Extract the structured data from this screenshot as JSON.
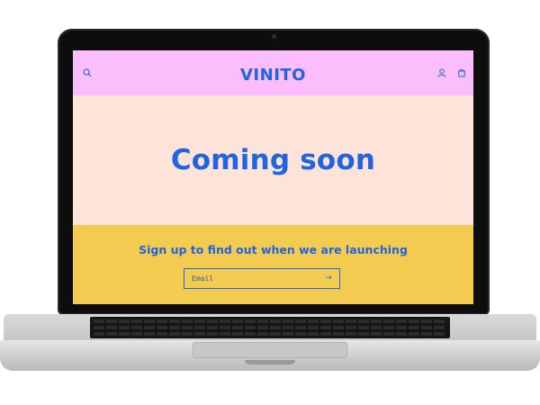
{
  "store": {
    "logo": "VINITO"
  },
  "header": {
    "icons": {
      "search": "search-icon",
      "account": "account-icon",
      "cart": "cart-icon"
    }
  },
  "hero": {
    "title": "Coming soon"
  },
  "signup": {
    "heading": "Sign up to find out when we are launching",
    "email_placeholder": "Email",
    "submit_icon": "→"
  },
  "colors": {
    "header_bg": "#fbbdfb",
    "hero_bg": "#fde3d8",
    "signup_bg": "#f2cb50",
    "accent": "#1f64e0"
  }
}
